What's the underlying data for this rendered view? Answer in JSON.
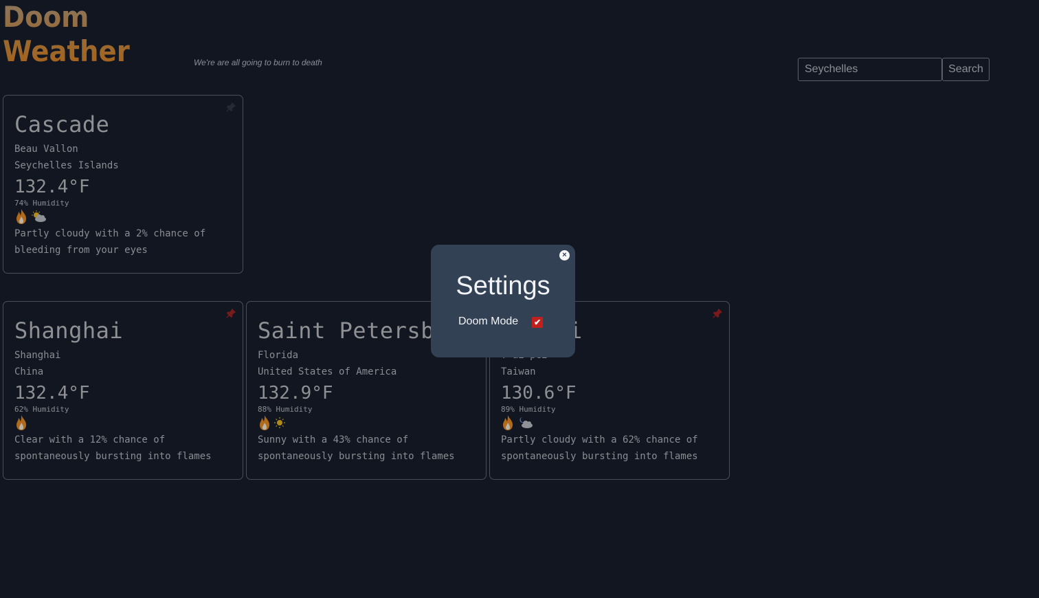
{
  "app": {
    "title": "Doom Weather",
    "tagline": "We're are all going to burn to death"
  },
  "search": {
    "value": "Seychelles",
    "button_label": "Search"
  },
  "colors": {
    "background": "#111620",
    "modal_background": "#334155",
    "pin_active": "#7a1a1a",
    "checkbox": "#c21f1f"
  },
  "cards": [
    {
      "city": "Cascade",
      "region": "Beau Vallon",
      "country": "Seychelles Islands",
      "temperature": "132.4°F",
      "humidity": "74% Humidity",
      "weather_icon": "partly-cloudy-day-icon",
      "description": "Partly cloudy with a 2% chance of bleeding from your eyes",
      "pinned": false
    },
    {
      "city": "Shanghai",
      "region": "Shanghai",
      "country": "China",
      "temperature": "132.4°F",
      "humidity": "62% Humidity",
      "weather_icon": "clear-night-icon",
      "description": "Clear with a 12% chance of spontaneously bursting into flames",
      "pinned": true
    },
    {
      "city": "Saint Petersburg",
      "region": "Florida",
      "country": "United States of America",
      "temperature": "132.9°F",
      "humidity": "88% Humidity",
      "weather_icon": "sunny-icon",
      "description": "Sunny with a 43% chance of spontaneously bursting into flames",
      "pinned": true
    },
    {
      "city": "Taipei",
      "region": "T'ai-pei",
      "country": "Taiwan",
      "temperature": "130.6°F",
      "humidity": "89% Humidity",
      "weather_icon": "partly-cloudy-night-icon",
      "description": "Partly cloudy with a 62% chance of spontaneously bursting into flames",
      "pinned": true
    }
  ],
  "settings_modal": {
    "title": "Settings",
    "close_label": "×",
    "doom_mode_label": "Doom Mode",
    "doom_mode_checked": true,
    "check_glyph": "✔"
  }
}
